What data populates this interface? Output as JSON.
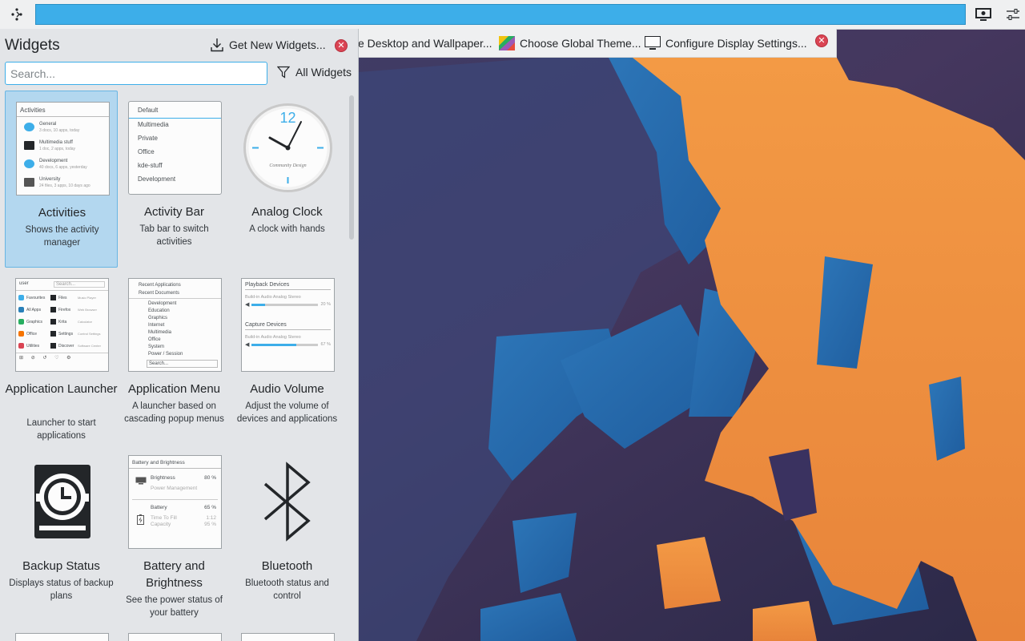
{
  "panel": {
    "handle_icon": "panel-handle-icon"
  },
  "toolbar": {
    "wallpaper_label": "e Desktop and Wallpaper...",
    "global_theme_label": "Choose Global Theme...",
    "display_label": "Configure Display Settings..."
  },
  "explorer": {
    "title": "Widgets",
    "get_new_label": "Get New Widgets...",
    "search_placeholder": "Search...",
    "filter_label": "All Widgets"
  },
  "widgets": [
    {
      "name": "Activities",
      "desc": "Shows the activity manager",
      "thumb": {
        "header": "Activities",
        "items": [
          [
            "General",
            "3 docs, 10 apps, today"
          ],
          [
            "Multimedia stuff",
            "1 doc, 2 apps, today"
          ],
          [
            "Development",
            "40 docs, 6 apps, yesterday"
          ],
          [
            "University",
            "24 files, 3 apps, 10 days ago"
          ]
        ]
      }
    },
    {
      "name": "Activity Bar",
      "desc": "Tab bar to switch activities",
      "thumb": {
        "items": [
          "Default",
          "Multimedia",
          "Private",
          "Office",
          "kde-stuff",
          "Development"
        ]
      }
    },
    {
      "name": "Analog Clock",
      "desc": "A clock with hands",
      "thumb": {
        "twelve": "12",
        "brand": "Community Design"
      }
    },
    {
      "name": "Application Launcher",
      "desc": "Launcher to start applications",
      "thumb": {
        "user": "user",
        "search": "Search...",
        "left": [
          "Favourites",
          "All Apps",
          "Graphics",
          "Office",
          "Utilities"
        ],
        "apps": [
          "Files",
          "Firefox",
          "Krita",
          "Settings",
          "Discover"
        ],
        "sub": [
          "Music Player",
          "Web Browser",
          "Calculator",
          "Control Settings",
          "Software Center"
        ]
      }
    },
    {
      "name": "Application Menu",
      "desc": "A launcher based on cascading popup menus",
      "thumb": {
        "top": [
          "Recent Applications",
          "Recent Documents"
        ],
        "items": [
          "Development",
          "Education",
          "Graphics",
          "Internet",
          "Multimedia",
          "Office",
          "System",
          "Power / Session"
        ],
        "search": "Search..."
      }
    },
    {
      "name": "Audio Volume",
      "desc": "Adjust the volume of devices and applications",
      "thumb": {
        "playback": "Playback Devices",
        "device1": "Build-in Audio Analog Stereo",
        "vol1": "20 %",
        "vol1_frac": 0.2,
        "capture": "Capture Devices",
        "device2": "Build-in Audio Analog Stereo",
        "vol2": "67 %",
        "vol2_frac": 0.67
      }
    },
    {
      "name": "Backup Status",
      "desc": "Displays status of backup plans",
      "thumb": {}
    },
    {
      "name": "Battery and Brightness",
      "desc": "See the power status of your battery",
      "thumb": {
        "header": "Battery and Brightness",
        "brightness": "Brightness",
        "brightness_val": "80 %",
        "power": "Power Management",
        "battery": "Battery",
        "battery_val": "65 %",
        "ttf": "Time To Fill",
        "ttf_val": "1:12",
        "cap": "Capacity",
        "cap_val": "95 %"
      }
    },
    {
      "name": "Bluetooth",
      "desc": "Bluetooth status and control",
      "thumb": {}
    }
  ],
  "colors": {
    "accent": "#3daee9",
    "close": "#da4453",
    "selection": "#b3d7ef"
  }
}
